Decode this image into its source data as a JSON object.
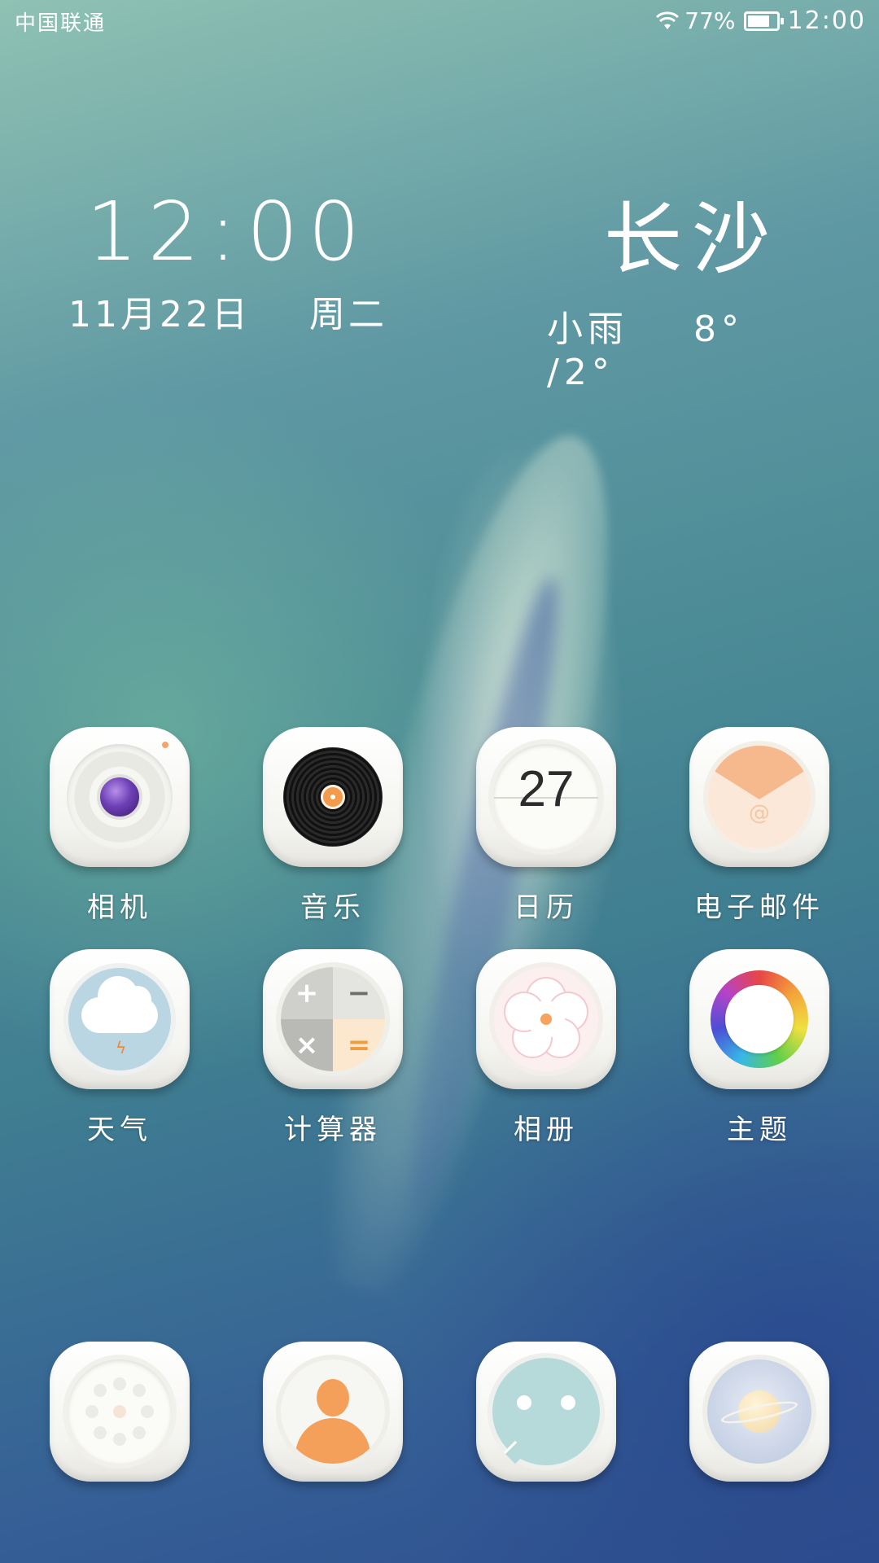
{
  "status_bar": {
    "carrier": "中国联通",
    "battery_text": "77%",
    "battery_level": 0.77,
    "time": "12:00",
    "icons": [
      "wifi-icon",
      "battery-icon"
    ]
  },
  "clock": {
    "time": "12:00",
    "date": "11月22日",
    "weekday": "周二"
  },
  "weather": {
    "city": "长沙",
    "condition": "小雨",
    "high": "8°",
    "low": "/2°"
  },
  "apps": [
    {
      "label": "相机",
      "icon": "camera-icon"
    },
    {
      "label": "音乐",
      "icon": "vinyl-record-icon"
    },
    {
      "label": "日历",
      "icon": "calendar-icon",
      "day": "27"
    },
    {
      "label": "电子邮件",
      "icon": "envelope-icon",
      "symbol": "@"
    },
    {
      "label": "天气",
      "icon": "cloud-lightning-icon"
    },
    {
      "label": "计算器",
      "icon": "calculator-icon",
      "symbols": [
        "+",
        "−",
        "×",
        "="
      ]
    },
    {
      "label": "相册",
      "icon": "flower-icon"
    },
    {
      "label": "主题",
      "icon": "color-ring-icon"
    }
  ],
  "dock": [
    {
      "icon": "dialpad-icon"
    },
    {
      "icon": "contact-person-icon"
    },
    {
      "icon": "message-bubble-icon"
    },
    {
      "icon": "planet-browser-icon"
    }
  ],
  "colors": {
    "accent_orange": "#f4a05a",
    "camera_lens": "#6d3fb6",
    "weather_bg": "#b9d6e2",
    "message_bg": "#b6d9d9"
  }
}
